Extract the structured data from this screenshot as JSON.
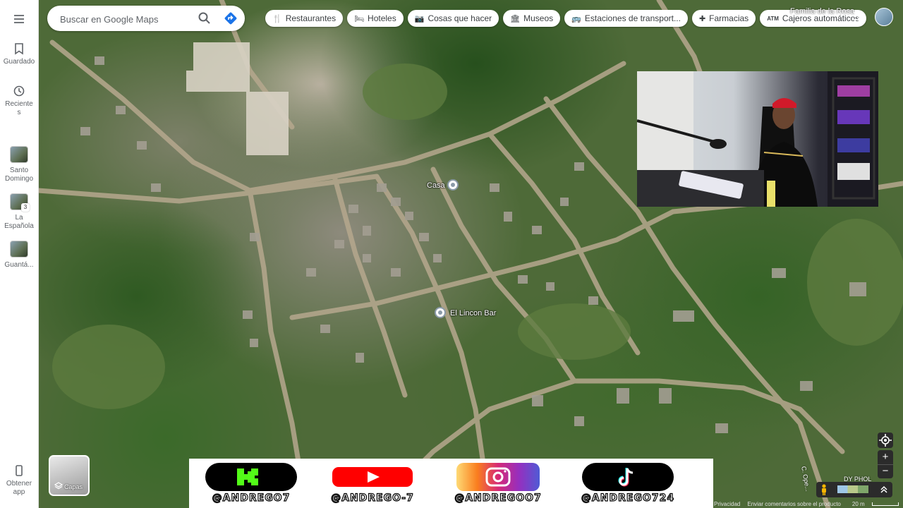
{
  "rail": {
    "menu_icon": "hamburger-icon",
    "items": [
      {
        "label": "Guardado",
        "icon": "bookmark-icon"
      },
      {
        "label": "Recientes",
        "icon": "history-icon"
      },
      {
        "label": "Santo Domingo",
        "icon": "thumbnail"
      },
      {
        "label": "La Española",
        "icon": "thumbnail",
        "badge": "3"
      },
      {
        "label": "Guantá...",
        "icon": "thumbnail"
      }
    ],
    "get_app": {
      "label": "Obtener app",
      "icon": "phone-icon"
    }
  },
  "search": {
    "placeholder": "Buscar en Google Maps",
    "search_icon": "search-icon",
    "directions_icon": "directions-icon"
  },
  "chips": [
    {
      "label": "Restaurantes",
      "icon": "fork-knife-icon"
    },
    {
      "label": "Hoteles",
      "icon": "bed-icon"
    },
    {
      "label": "Cosas que hacer",
      "icon": "camera-icon"
    },
    {
      "label": "Museos",
      "icon": "museum-icon"
    },
    {
      "label": "Estaciones de transport...",
      "icon": "bus-icon"
    },
    {
      "label": "Farmacias",
      "icon": "pharmacy-icon"
    },
    {
      "label": "Cajeros automáticos",
      "icon": "atm-icon"
    }
  ],
  "top_right": {
    "place_label": "Familia de la Rosa",
    "apps_icon": "apps-grid-icon",
    "avatar_icon": "avatar"
  },
  "map": {
    "places": [
      {
        "label": "Casa"
      },
      {
        "label": "El Lincon Bar"
      }
    ],
    "road_labels": [
      "C. Ope...",
      "DY PHOL"
    ]
  },
  "layers": {
    "label": "Capas",
    "icon": "layers-icon"
  },
  "social": [
    {
      "handle": "@ANDREGO7",
      "platform": "kick",
      "color": "#53fc18"
    },
    {
      "handle": "@ANDREGO-7",
      "platform": "youtube",
      "color": "#ff0000"
    },
    {
      "handle": "@ANDREGOO7",
      "platform": "instagram",
      "color": "#d62976"
    },
    {
      "handle": "@ANDREGO724",
      "platform": "tiktok",
      "color": "#000000"
    }
  ],
  "controls": {
    "locate_icon": "my-location-icon",
    "zoom_in": "+",
    "zoom_out": "−",
    "pegman_icon": "pegman-icon",
    "expand_icon": "chevron-up-icon"
  },
  "footer": {
    "privacy": "Privacidad",
    "feedback": "Enviar comentarios sobre el producto",
    "scale": "20 m"
  }
}
